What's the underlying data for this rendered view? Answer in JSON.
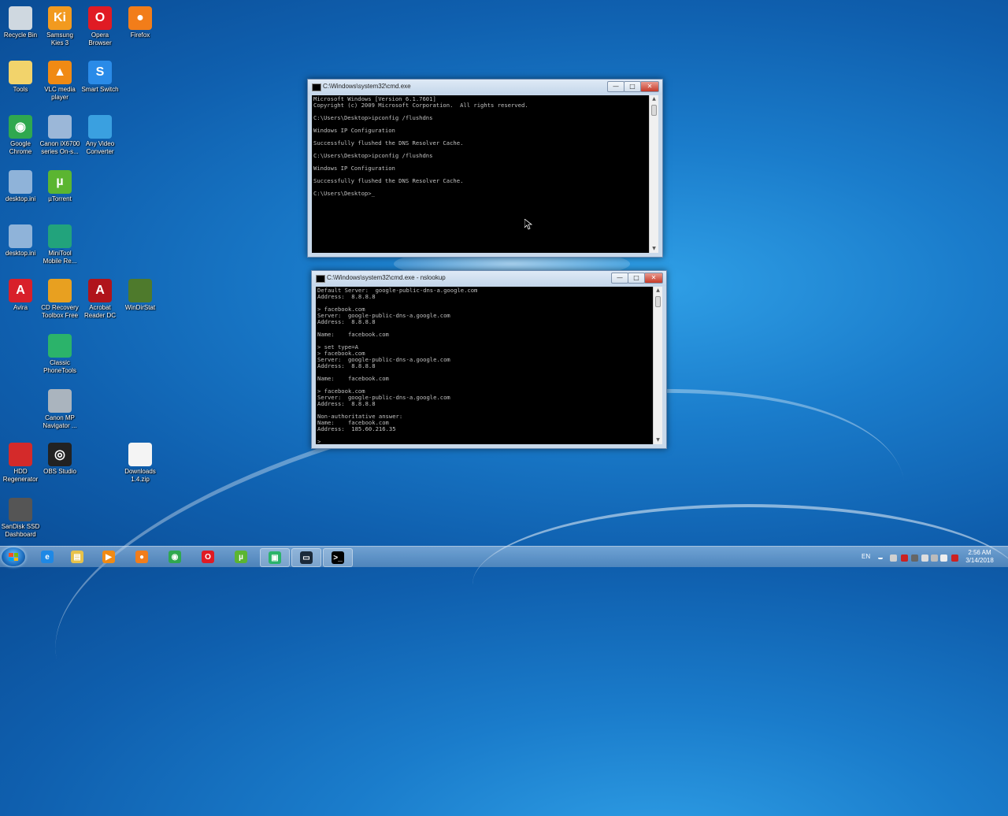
{
  "desktop": {
    "icons": [
      {
        "label": "Recycle Bin",
        "icon": "recycle-bin-icon",
        "color": "#cfd8e0"
      },
      {
        "label": "Samsung\nKies 3",
        "icon": "samsung-kies-icon",
        "color": "#f29a1f",
        "glyph": "Ki"
      },
      {
        "label": "Opera\nBrowser",
        "icon": "opera-icon",
        "color": "#e01b24",
        "glyph": "O"
      },
      {
        "label": "Firefox",
        "icon": "firefox-icon",
        "color": "#f27d1a",
        "glyph": "●"
      },
      {
        "label": "Tools",
        "icon": "tools-folder-icon",
        "color": "#f2d36b"
      },
      {
        "label": "VLC media\nplayer",
        "icon": "vlc-icon",
        "color": "#f08a14",
        "glyph": "▲"
      },
      {
        "label": "Smart Switch",
        "icon": "smart-switch-icon",
        "color": "#2a8be8",
        "glyph": "S"
      },
      {
        "label": "Google\nChrome",
        "icon": "chrome-icon",
        "color": "#2fa84f",
        "glyph": "◉"
      },
      {
        "label": "Canon iX6700\nseries On-s...",
        "icon": "canon-manual-icon",
        "color": "#9bb7d8"
      },
      {
        "label": "Any Video\nConverter",
        "icon": "any-video-converter-icon",
        "color": "#3aa0e0"
      },
      {
        "label": "desktop.ini",
        "icon": "ini-file-icon",
        "color": "#8fb3d9"
      },
      {
        "label": "µTorrent",
        "icon": "utorrent-icon",
        "color": "#5bb531",
        "glyph": "µ"
      },
      {
        "label": "desktop.ini",
        "icon": "ini-file-icon",
        "color": "#8fb3d9"
      },
      {
        "label": "MiniTool\nMobile Re...",
        "icon": "minitool-icon",
        "color": "#22a37c"
      },
      {
        "label": "Avira",
        "icon": "avira-icon",
        "color": "#d8202a",
        "glyph": "A"
      },
      {
        "label": "CD Recovery\nToolbox Free",
        "icon": "cd-recovery-icon",
        "color": "#e8a020"
      },
      {
        "label": "Acrobat\nReader DC",
        "icon": "acrobat-icon",
        "color": "#b0141b",
        "glyph": "A"
      },
      {
        "label": "WinDirStat",
        "icon": "windirstat-icon",
        "color": "#4e7a2c"
      },
      {
        "label": "Classic\nPhoneTools",
        "icon": "classic-phonetools-icon",
        "color": "#2bb36a"
      },
      {
        "label": "Canon MP\nNavigator ...",
        "icon": "canon-mp-navigator-icon",
        "color": "#aab4be"
      },
      {
        "label": "HDD\nRegenerator",
        "icon": "hdd-regenerator-icon",
        "color": "#d42a2a"
      },
      {
        "label": "OBS Studio",
        "icon": "obs-icon",
        "color": "#222222",
        "glyph": "◎"
      },
      {
        "label": "Downloads\n1.4.zip",
        "icon": "text-file-icon",
        "color": "#f4f4f4"
      },
      {
        "label": "SanDisk SSD\nDashboard",
        "icon": "sandisk-icon",
        "color": "#555555"
      }
    ]
  },
  "cmd1": {
    "title": "C:\\Windows\\system32\\cmd.exe",
    "content": "Microsoft Windows [Version 6.1.7601]\nCopyright (c) 2009 Microsoft Corporation.  All rights reserved.\n\nC:\\Users\\Desktop>ipconfig /flushdns\n\nWindows IP Configuration\n\nSuccessfully flushed the DNS Resolver Cache.\n\nC:\\Users\\Desktop>ipconfig /flushdns\n\nWindows IP Configuration\n\nSuccessfully flushed the DNS Resolver Cache.\n\nC:\\Users\\Desktop>_"
  },
  "cmd2": {
    "title": "C:\\Windows\\system32\\cmd.exe - nslookup",
    "content": "Default Server:  google-public-dns-a.google.com\nAddress:  8.8.8.8\n\n> facebook.com\nServer:  google-public-dns-a.google.com\nAddress:  8.8.8.8\n\nName:    facebook.com\n\n> set type=A\n> facebook.com\nServer:  google-public-dns-a.google.com\nAddress:  8.8.8.8\n\nName:    facebook.com\n\n> facebook.com\nServer:  google-public-dns-a.google.com\nAddress:  8.8.8.8\n\nNon-authoritative answer:\nName:    facebook.com\nAddress:  185.60.216.35\n\n>"
  },
  "window_buttons": {
    "minimize": "—",
    "maximize": "□",
    "close": "✕"
  },
  "taskbar": {
    "items": [
      {
        "icon": "internet-explorer-icon",
        "color": "#1e88e5",
        "glyph": "e"
      },
      {
        "icon": "file-explorer-icon",
        "color": "#e8c24a",
        "glyph": "▤"
      },
      {
        "icon": "media-player-icon",
        "color": "#f08a14",
        "glyph": "▶"
      },
      {
        "icon": "firefox-icon",
        "color": "#f27d1a",
        "glyph": "●"
      },
      {
        "icon": "chrome-icon",
        "color": "#2fa84f",
        "glyph": "◉"
      },
      {
        "icon": "opera-icon",
        "color": "#e01b24",
        "glyph": "O"
      },
      {
        "icon": "utorrent-icon",
        "color": "#5bb531",
        "glyph": "µ"
      },
      {
        "icon": "classic-phonetools-icon",
        "color": "#2bb36a",
        "glyph": "▣"
      },
      {
        "icon": "screen-recorder-icon",
        "color": "#1b2a3a",
        "glyph": "▭"
      },
      {
        "icon": "cmd-icon",
        "color": "#000000",
        "glyph": ">_"
      }
    ],
    "language": "EN",
    "time": "2:56 AM",
    "date": "3/14/2018"
  }
}
